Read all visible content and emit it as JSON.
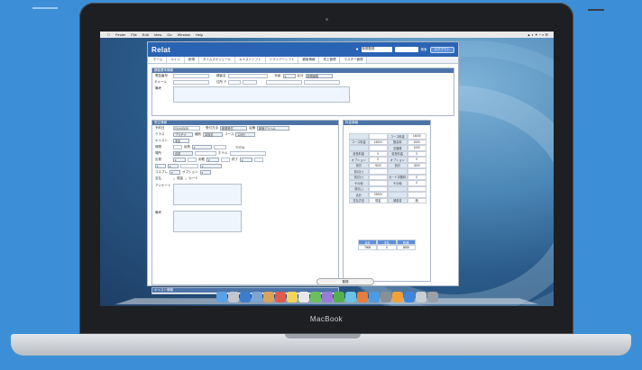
{
  "menubar": {
    "items": [
      "Finder",
      "File",
      "Edit",
      "View",
      "Go",
      "Window",
      "Help"
    ]
  },
  "app": {
    "logo": "Relat",
    "header_select": "新規登録",
    "search_label": "検索",
    "login_label": "ログアウト"
  },
  "tabs": [
    "ホーム",
    "メイン",
    "新規",
    "タイムスケジュール",
    "キャストシフト",
    "ドライバーシフト",
    "顧客情報",
    "売上管理",
    "マスター管理"
  ],
  "customer_panel": {
    "title": "顧客基本情報",
    "phone_label": "電話番号",
    "name_label": "顧客名",
    "age_label": "年齢",
    "rank_label": "区分",
    "rank_value": "新規顧客",
    "email_label": "Eメール",
    "address_label": "住所 〒",
    "memo_label": "備考"
  },
  "order_panel": {
    "title": "受注情報",
    "date_label": "予約日",
    "date_value": "2014/03/28",
    "type_label": "受付方法",
    "type_value": "新規受付",
    "store_label": "店舗",
    "store_value": "新宿デリヘル",
    "class_label": "クラス",
    "class_value": "プラチナ",
    "course_type_label": "種別",
    "course_type_value": "本指名",
    "course_label": "コース",
    "course_value": "120分",
    "cast_label": "キャスト",
    "cast_value": "未定",
    "time_label": "時間",
    "extension_label": "延長",
    "total_label": "TOTAL",
    "place_label": "場所",
    "place_value": "自宅",
    "hotel_label": "ホテル",
    "start_label": "出発",
    "arrive_label": "到着",
    "end_label": "終了",
    "cosplay_label": "コスプレ",
    "option_label": "オプション",
    "payment_label": "支払",
    "payment_cash": "現金",
    "payment_card": "カード",
    "survey_label": "アンケート",
    "note_label": "備考"
  },
  "fee_panel": {
    "title": "料金情報",
    "rows": [
      [
        "",
        "",
        "コース料金",
        "14000"
      ],
      [
        "コース料金",
        "16000",
        "指名料",
        "2000"
      ],
      [
        "",
        "",
        "交通費",
        "1000"
      ],
      [
        "延長料金",
        "0",
        "延長料金",
        "0"
      ],
      [
        "オプション",
        "0",
        "オプション",
        "0"
      ],
      [
        "割引",
        "3000",
        "割引",
        "3000"
      ],
      [
        "割引(+)",
        "",
        "",
        ""
      ],
      [
        "割引(+)",
        "",
        "カード手数料",
        "0"
      ],
      [
        "その他",
        "",
        "その他",
        "0"
      ],
      [
        "割引(-)",
        "",
        "",
        ""
      ],
      [
        "合計",
        "23000",
        "",
        ""
      ],
      [
        "支払方法",
        "現金",
        "領収書",
        "無"
      ]
    ],
    "summary": {
      "headers": [
        "合計",
        "支払",
        "釣銭"
      ],
      "values": [
        "7000",
        "0",
        "2000"
      ]
    }
  },
  "cast_panel": {
    "title": "キャスト情報"
  },
  "save_button": "登録",
  "laptop_brand": "MacBook",
  "colors": {
    "app_header": "#2a63b3",
    "panel_title": "#4d74a8",
    "background": "#3c8fd6"
  }
}
